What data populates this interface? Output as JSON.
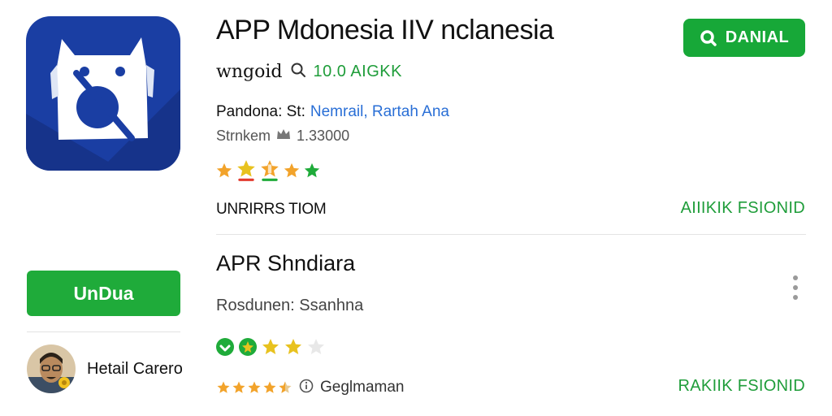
{
  "colors": {
    "accent_green": "#1fab3a",
    "link_blue": "#2a6fd6",
    "icon_blue": "#1a3ea3",
    "star_orange": "#f2a32b",
    "star_yellow": "#e8c21f",
    "star_green": "#1fab3a",
    "star_empty": "#dddddd"
  },
  "app": {
    "icon": "app-logo-icon",
    "title": "APP Mdonesia IIV nclanesia",
    "install_label": "DANIAL",
    "install_icon": "search-icon",
    "developer": "wngoid",
    "search_value": "10.0 AIGKK",
    "search_icon": "search-icon",
    "publisher_label": "Pandona: St:",
    "publisher_link": "Nemrail, Rartah Ana",
    "stat_label": "Strnkem",
    "stat_icon": "crown-icon",
    "stat_value": "1.33000",
    "rating": 5,
    "meta_left": "UNRIRRS TIOM",
    "meta_right": "AIIIKIK FSIONID"
  },
  "app2": {
    "title": "APR Shndiara",
    "menu_icon": "more-vertical-icon",
    "publisher": "Rosdunen: Ssanhna",
    "rating": 3,
    "install_label": "UnDua"
  },
  "review": {
    "avatar_icon": "avatar-icon",
    "reviewer_name": "Hetail Carero",
    "rating": 4.5,
    "info_icon": "info-icon",
    "label": "Geglmaman",
    "action": "RAKIIK FSIONID"
  }
}
